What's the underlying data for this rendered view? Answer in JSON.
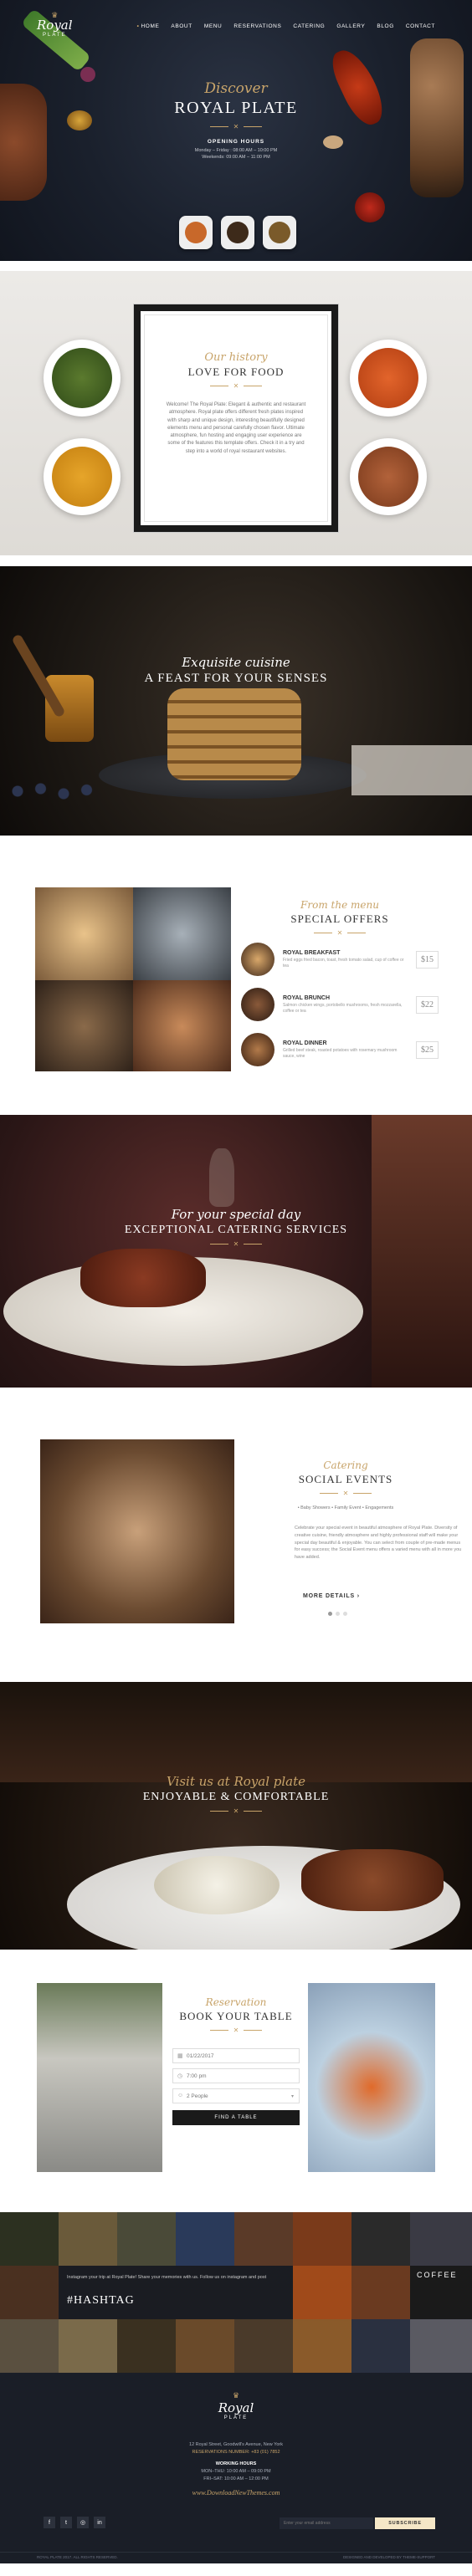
{
  "nav": {
    "logo_name": "Royal",
    "logo_sub": "PLATE",
    "items": [
      "HOME",
      "ABOUT",
      "MENU",
      "RESERVATIONS",
      "CATERING",
      "GALLERY",
      "BLOG",
      "CONTACT"
    ]
  },
  "hero": {
    "script": "Discover",
    "title": "ROYAL PLATE",
    "hours_title": "OPENING HOURS",
    "hours_line1": "Monday – Friday : 08:00 AM – 10:00 PM",
    "hours_line2": "Weekends: 09:00 AM – 11:00 PM"
  },
  "history": {
    "script": "Our history",
    "title": "LOVE FOR FOOD",
    "body": "Welcome! The Royal Plate: Elegant & authentic and restaurant atmosphere. Royal plate offers different fresh plates inspired with sharp and unique design, interesting beautifully designed elements menu and personal carefully chosen flavor. Ultimate atmosphere, fun hosting and engaging user experience are some of the features this template offers. Check it in a try and step into a world of royal restaurant websites."
  },
  "pancake": {
    "script": "Exquisite cuisine",
    "title": "A FEAST FOR YOUR SENSES"
  },
  "offers": {
    "script": "From the menu",
    "title": "SPECIAL OFFERS",
    "items": [
      {
        "name": "ROYAL BREAKFAST",
        "desc": "Fried eggs fried bacon, toast, fresh tomato salad, cup of coffee or tea",
        "price": "$15"
      },
      {
        "name": "ROYAL BRUNCH",
        "desc": "Salmon chicken wings, portobello mushrooms, fresh mozzarella, coffee or tea",
        "price": "$22"
      },
      {
        "name": "ROYAL DINNER",
        "desc": "Grilled beef steak, roasted potatoes with rosemary mushroom sauce, wine",
        "price": "$25"
      }
    ]
  },
  "catering": {
    "script": "For your special day",
    "title": "EXCEPTIONAL CATERING SERVICES"
  },
  "events": {
    "script": "Catering",
    "title": "SOCIAL EVENTS",
    "stats": "• Baby Showers   • Family Event   • Engagements",
    "body": "Celebrate your special event in beautiful atmosphere of Royal Plate. Diversity of creative cuisine, friendly atmosphere and highly professional staff will make your special day beautiful & enjoyable. You can select from couple of pre-made menus for easy success; the Social Event menu offers a varied menu with all in more you have added.",
    "more": "MORE DETAILS ›"
  },
  "visit": {
    "script": "Visit us at Royal plate",
    "title": "ENJOYABLE & COMFORTABLE"
  },
  "reserve": {
    "script": "Reservation",
    "title": "BOOK YOUR TABLE",
    "date_placeholder": "01/22/2017",
    "time_placeholder": "7:00 pm",
    "people_placeholder": "2 People",
    "button": "FIND A TABLE"
  },
  "instagram": {
    "text": "Instagram your trip at Royal Plate! Share your memories with us. Follow us on instagram and post",
    "hashtag": "#HASHTAG",
    "coffee_word": "COFFEE"
  },
  "footer": {
    "logo_name": "Royal",
    "logo_sub": "PLATE",
    "address": "12 Royal Street, Goodwill's Avenue, New York",
    "reservations": "RESERVATIONS NUMBER: +83 (01) 7852",
    "hours_title": "WORKING HOURS",
    "hours_line1": "MON–THU: 10:00 AM – 09:00 PM",
    "hours_line2": "FRI–SAT: 10:00 AM – 12:00 PM",
    "website": "www.DownloadNewThemes.com",
    "email_placeholder": "Enter your email address",
    "subscribe": "SUBSCRIBE",
    "copyright": "ROYAL PLATE 2017. ALL RIGHTS RESERVED.",
    "credits": "DESIGNED AND DEVELOPED BY THEME-SUPPORT"
  },
  "colors": {
    "accent": "#c8a46a",
    "dark": "#1c2230"
  }
}
